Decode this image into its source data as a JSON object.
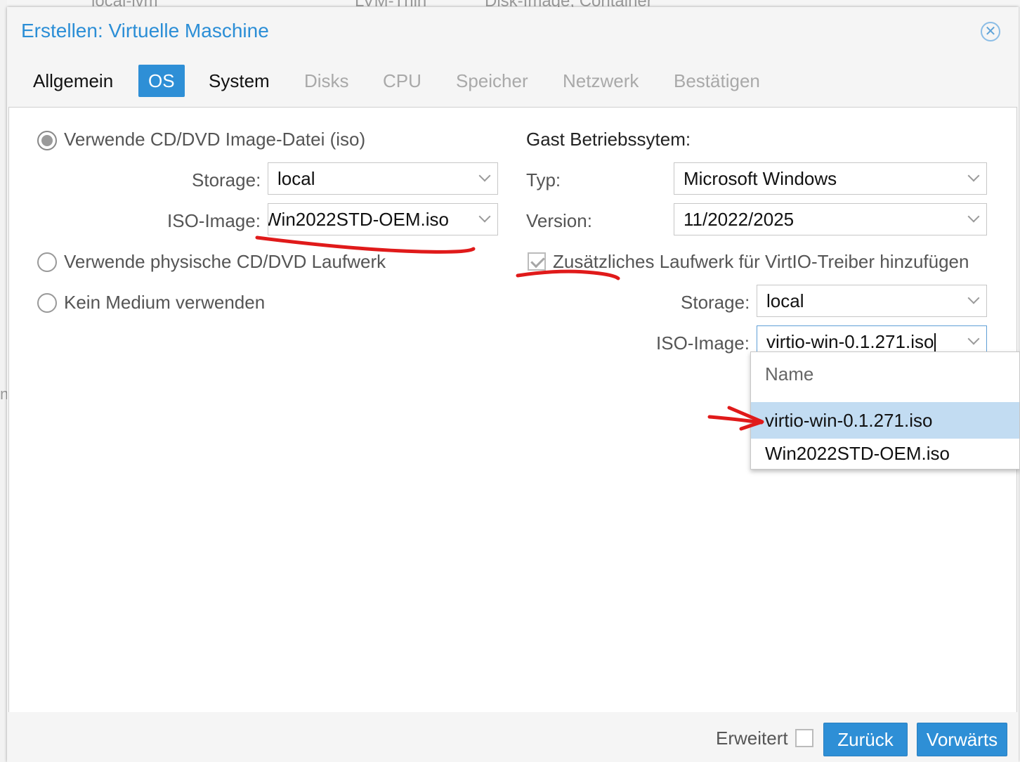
{
  "background": {
    "hint_1": "local-lvm",
    "hint_2": "LVM-Thin",
    "hint_3": "Disk-Image, Container",
    "left_mark": "n"
  },
  "dialog": {
    "title": "Erstellen: Virtuelle Maschine",
    "close_icon": "close-circle-icon"
  },
  "tabs": [
    {
      "label": "Allgemein",
      "state": "enabled"
    },
    {
      "label": "OS",
      "state": "active"
    },
    {
      "label": "System",
      "state": "enabled"
    },
    {
      "label": "Disks",
      "state": "disabled"
    },
    {
      "label": "CPU",
      "state": "disabled"
    },
    {
      "label": "Speicher",
      "state": "disabled"
    },
    {
      "label": "Netzwerk",
      "state": "disabled"
    },
    {
      "label": "Bestätigen",
      "state": "disabled"
    }
  ],
  "media": {
    "option_iso": {
      "label": "Verwende CD/DVD Image-Datei (iso)",
      "checked": true
    },
    "storage_label": "Storage:",
    "storage_value": "local",
    "iso_label": "ISO-Image:",
    "iso_value": "Win2022STD-OEM.iso",
    "option_physical": {
      "label": "Verwende physische CD/DVD Laufwerk",
      "checked": false
    },
    "option_none": {
      "label": "Kein Medium verwenden",
      "checked": false
    }
  },
  "guest_os": {
    "heading": "Gast Betriebssytem:",
    "type_label": "Typ:",
    "type_value": "Microsoft Windows",
    "version_label": "Version:",
    "version_value": "11/2022/2025",
    "virtio_checkbox": {
      "label": "Zusätzliches Laufwerk für VirtIO-Treiber hinzufügen",
      "checked": true
    },
    "virtio_storage_label": "Storage:",
    "virtio_storage_value": "local",
    "virtio_iso_label": "ISO-Image:",
    "virtio_iso_value": "virtio-win-0.1.271.iso"
  },
  "iso_dropdown": {
    "column_header": "Name",
    "options": [
      "virtio-win-0.1.271.iso",
      "Win2022STD-OEM.iso"
    ],
    "selected": "virtio-win-0.1.271.iso"
  },
  "footer": {
    "advanced_label": "Erweitert",
    "advanced_checked": false,
    "back_button": "Zurück",
    "next_button": "Vorwärts"
  },
  "colors": {
    "accent": "#2e8fd6",
    "annotation": "#e01a1a",
    "selected_row": "#c2dcf2"
  }
}
